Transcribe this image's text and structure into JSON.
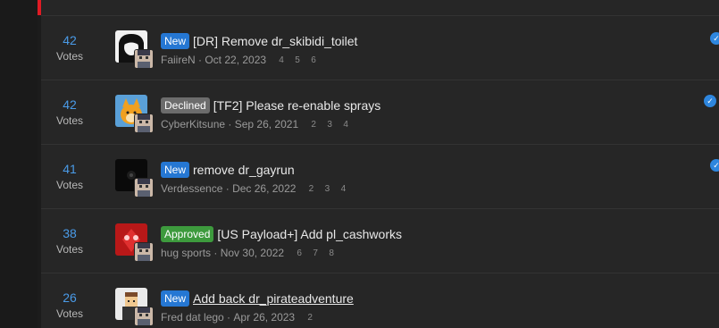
{
  "threads": [
    {
      "votes": "42",
      "votes_label": "Votes",
      "badge": "New",
      "title": "[DR] Remove dr_skibidi_toilet",
      "author": "FaiireN",
      "date": "Oct 22, 2023",
      "pages": [
        "4",
        "5",
        "6"
      ]
    },
    {
      "votes": "42",
      "votes_label": "Votes",
      "badge": "Declined",
      "title": "[TF2] Please re-enable sprays",
      "author": "CyberKitsune",
      "date": "Sep 26, 2021",
      "pages": [
        "2",
        "3",
        "4"
      ]
    },
    {
      "votes": "41",
      "votes_label": "Votes",
      "badge": "New",
      "title": "remove dr_gayrun",
      "author": "Verdessence",
      "date": "Dec 26, 2022",
      "pages": [
        "2",
        "3",
        "4"
      ]
    },
    {
      "votes": "38",
      "votes_label": "Votes",
      "badge": "Approved",
      "title": "[US Payload+] Add pl_cashworks",
      "author": "hug sports",
      "date": "Nov 30, 2022",
      "pages": [
        "6",
        "7",
        "8"
      ]
    },
    {
      "votes": "26",
      "votes_label": "Votes",
      "badge": "New",
      "title": "Add back dr_pirateadventure",
      "author": "Fred dat lego",
      "date": "Apr 26, 2023",
      "pages": [
        "2"
      ]
    }
  ],
  "icons": {
    "vote": "thumbs-up-icon"
  },
  "colors": {
    "accent": "#4a9be8",
    "new_badge": "#2577d3",
    "declined_badge": "#6c6c6c",
    "approved_badge": "#3d9a3d",
    "sidebar_accent": "#e01b24"
  }
}
